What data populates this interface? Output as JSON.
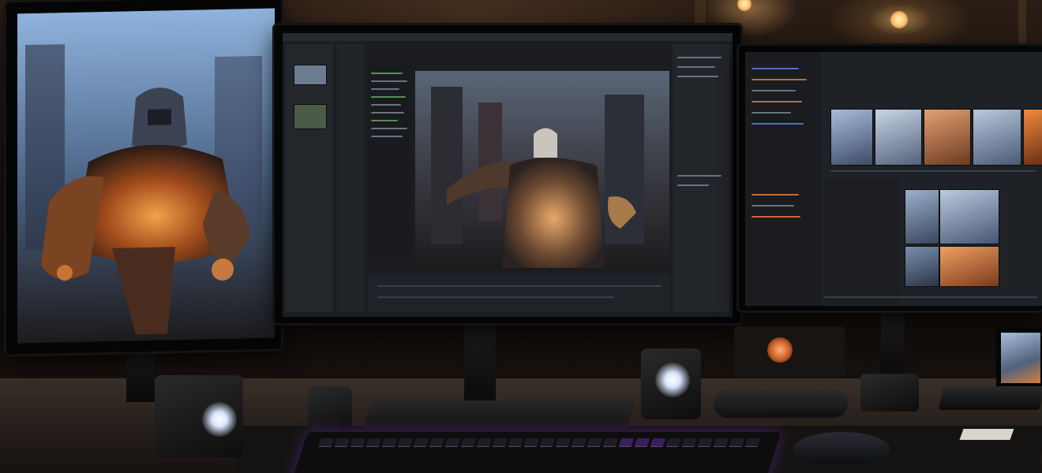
{
  "scene": {
    "description_tag": "",
    "accent_colors": {
      "keyboard_glow": "#9b4dff",
      "screen_sky": "#8aa9cc",
      "fire_orange": "#e0782a",
      "desk_wood": "#3a3029"
    },
    "objects": {
      "left_monitor": {
        "icon": "monitor-icon"
      },
      "center_monitor": {
        "icon": "monitor-icon"
      },
      "right_monitor": {
        "icon": "monitor-icon"
      },
      "speakers": {
        "icon": "speaker-icon"
      },
      "keyboard": {
        "icon": "keyboard-icon"
      },
      "mouse": {
        "icon": "mouse-icon"
      },
      "gamepad": {
        "icon": "gamepad-icon"
      },
      "laptop": {
        "icon": "laptop-icon"
      }
    }
  }
}
